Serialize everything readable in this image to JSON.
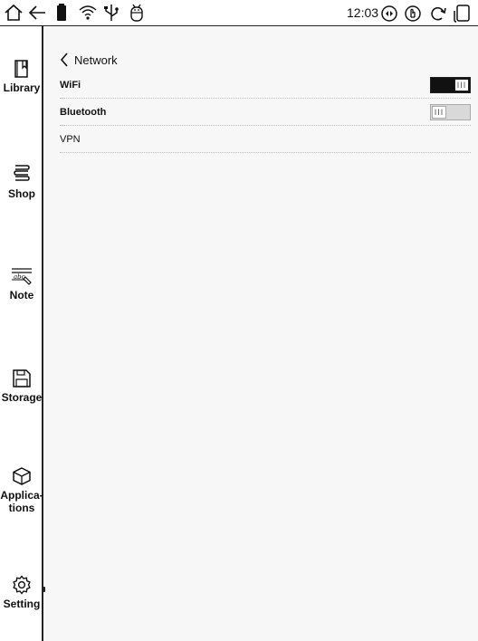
{
  "status_bar": {
    "icons_left": [
      "home-icon",
      "back-icon",
      "battery-icon",
      "wifi-icon",
      "usb-icon",
      "android-debug-icon"
    ],
    "time": "12:03",
    "icons_right": [
      "auto-rotate-icon",
      "touch-icon",
      "refresh-icon",
      "screen-mode-icon"
    ]
  },
  "sidebar": {
    "items": [
      {
        "label": "Library",
        "icon": "library-icon"
      },
      {
        "label": "Shop",
        "icon": "shop-icon"
      },
      {
        "label": "Note",
        "icon": "note-icon"
      },
      {
        "label": "Storage",
        "icon": "storage-icon"
      },
      {
        "label": "Applica-tions",
        "icon": "applications-icon"
      },
      {
        "label": "Setting",
        "icon": "setting-icon"
      }
    ]
  },
  "page": {
    "title": "Network",
    "back_icon": "chevron-left-icon"
  },
  "settings": [
    {
      "label": "WiFi",
      "type": "toggle",
      "state": "on",
      "knob_text": "III"
    },
    {
      "label": "Bluetooth",
      "type": "toggle",
      "state": "off",
      "knob_text": "III"
    },
    {
      "label": "VPN",
      "type": "link"
    }
  ]
}
